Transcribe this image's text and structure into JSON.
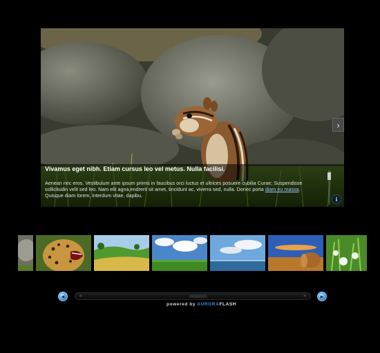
{
  "slideshow": {
    "caption_title": "Vivamus eget nibh. Etiam cursus leo vel metus. Nulla facilisi.",
    "caption_body_before_link": "Aenean nec eros. Vestibulum ante ipsum primis in faucibus orci luctus et ultrices posuere cubilia Curae; Suspendisse sollicitudin velit sed leo. Nam elit agna,endrerit sit amet, tincidunt ac, viverra sed, nulla. Donec porta ",
    "caption_link": "diam eu massa",
    "caption_body_after_link": ". Quisque diam lorem, interdum vitae, dapibu.",
    "info_label": "i",
    "next_arrow": "›"
  },
  "thumbnails": [
    {
      "subject": "rock"
    },
    {
      "subject": "jaguar"
    },
    {
      "subject": "green-hills"
    },
    {
      "subject": "field-and-clouds"
    },
    {
      "subject": "sea-horizon"
    },
    {
      "subject": "hay-bale"
    },
    {
      "subject": "white-flowers"
    }
  ],
  "strip_nav": {
    "left_arrow": "«",
    "right_arrow": "»"
  },
  "footer": {
    "powered_prefix": "powered by ",
    "brand_part1": "AURORA",
    "brand_part2": "FLASH"
  },
  "colors": {
    "background": "#000000",
    "link": "#9ec6ff",
    "brand_blue": "#3c8fe0"
  }
}
